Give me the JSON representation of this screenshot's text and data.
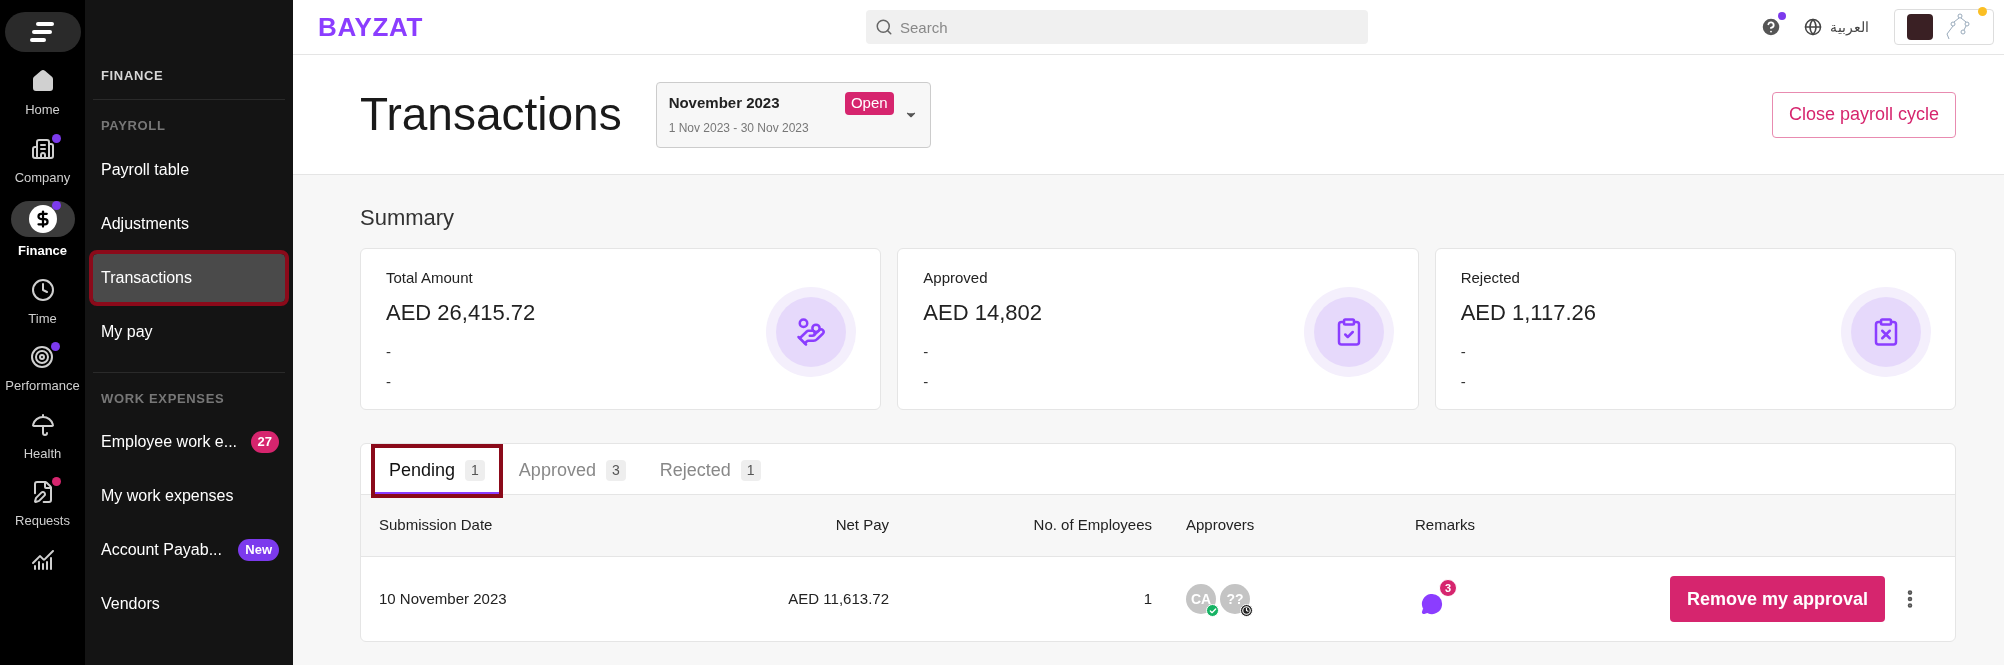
{
  "rail": {
    "items": [
      {
        "label": "Home",
        "kind": "home",
        "selected": false
      },
      {
        "label": "Company",
        "kind": "building",
        "selected": false,
        "color": "#7c3aed"
      },
      {
        "label": "Finance",
        "kind": "dollar",
        "selected": true,
        "color": "#7c3aed"
      },
      {
        "label": "Time",
        "kind": "clock",
        "selected": false
      },
      {
        "label": "Performance",
        "kind": "target",
        "selected": false,
        "color": "#7c3aed"
      },
      {
        "label": "Health",
        "kind": "umbrella",
        "selected": false
      },
      {
        "label": "Requests",
        "kind": "request",
        "selected": false,
        "color": "#d6256e"
      },
      {
        "kind": "chart",
        "selected": false
      }
    ]
  },
  "sidebar": {
    "title": "FINANCE",
    "groups": [
      {
        "title": "PAYROLL",
        "items": [
          {
            "label": "Payroll table",
            "selected": false,
            "highlighted": false
          },
          {
            "label": "Adjustments",
            "selected": false,
            "highlighted": false
          },
          {
            "label": "Transactions",
            "selected": true,
            "highlighted": true
          },
          {
            "label": "My pay",
            "selected": false,
            "highlighted": false
          }
        ]
      },
      {
        "title": "WORK EXPENSES",
        "items": [
          {
            "label": "Employee work e...",
            "selected": false,
            "highlighted": false,
            "badge": "27",
            "kind": "count"
          },
          {
            "label": "My work expenses",
            "selected": false,
            "highlighted": false
          },
          {
            "label": "Account Payab...",
            "selected": false,
            "highlighted": false,
            "badge": "New",
            "kind": "new"
          },
          {
            "label": "Vendors",
            "selected": false,
            "highlighted": false
          }
        ]
      }
    ]
  },
  "topbar": {
    "logo": "BAYZAT",
    "search": {
      "placeholder": "Search"
    },
    "language": "العربية"
  },
  "header": {
    "title": "Transactions",
    "period": {
      "name": "November 2023",
      "status": "Open",
      "range": "1 Nov 2023 - 30 Nov 2023"
    },
    "action": "Close payroll cycle"
  },
  "summary": {
    "title": "Summary",
    "cards": [
      {
        "label": "Total Amount",
        "value": "AED 26,415.72",
        "line_1": "-",
        "line_2": "-",
        "kind": "money"
      },
      {
        "label": "Approved",
        "value": "AED 14,802",
        "line_1": "-",
        "line_2": "-",
        "kind": "approved"
      },
      {
        "label": "Rejected",
        "value": "AED 1,117.26",
        "line_1": "-",
        "line_2": "-",
        "kind": "rejected"
      }
    ]
  },
  "tabs": [
    {
      "label": "Pending",
      "count": "1",
      "selected": true,
      "highlighted": true
    },
    {
      "label": "Approved",
      "count": "3",
      "selected": false,
      "highlighted": false
    },
    {
      "label": "Rejected",
      "count": "1",
      "selected": false,
      "highlighted": false
    }
  ],
  "table": {
    "columns": [
      "Submission Date",
      "Net Pay",
      "No. of Employees",
      "Approvers",
      "Remarks"
    ],
    "rows": [
      {
        "date": "10 November 2023",
        "net_pay": "AED 11,613.72",
        "employees": "1",
        "approvers": [
          {
            "initials": "CA",
            "approved": true
          },
          {
            "initials": "??",
            "approved": false
          }
        ],
        "remarks": "3",
        "action": "Remove my approval"
      }
    ]
  }
}
